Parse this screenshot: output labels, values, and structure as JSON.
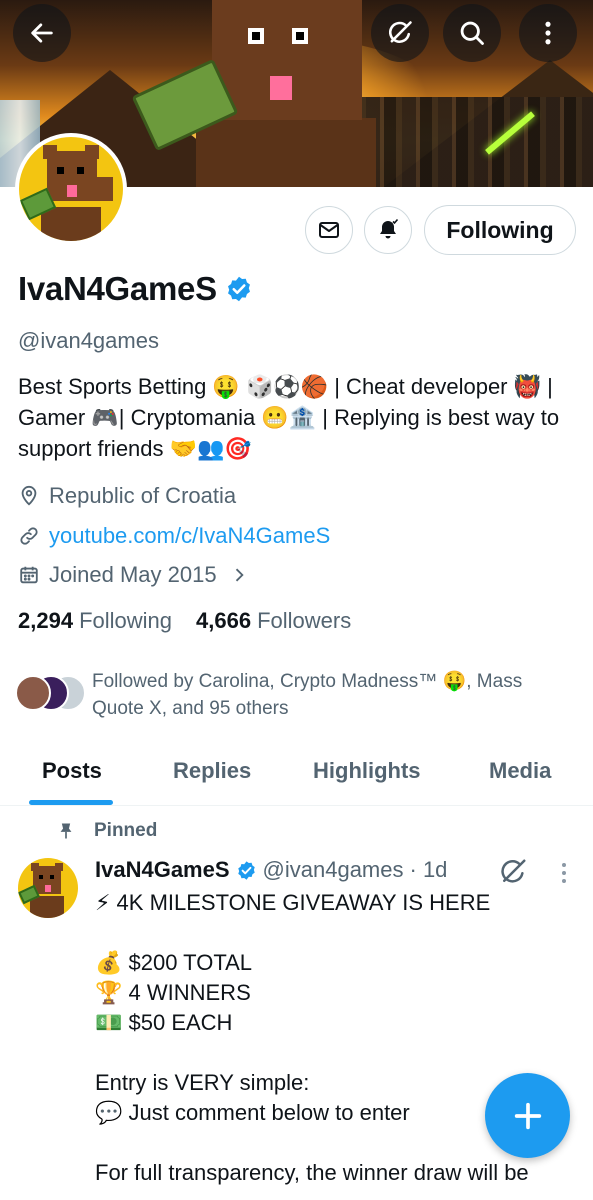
{
  "profile": {
    "name": "IvaN4GameS",
    "handle": "@ivan4games",
    "bio": "Best Sports Betting 🤑 🎲⚽🏀 | Cheat developer 👹 | Gamer 🎮| Cryptomania 😬🏦 | Replying is best way to support friends 🤝👥🎯",
    "location": "Republic of Croatia",
    "website": "youtube.com/c/IvaN4GameS",
    "joined": "Joined May 2015",
    "following_count": "2,294",
    "following_label": "Following",
    "followers_count": "4,666",
    "followers_label": "Followers",
    "followed_by": "Followed by Carolina, Crypto Madness™ 🤑, Mass Quote X, and 95 others"
  },
  "actions": {
    "follow_state": "Following"
  },
  "tabs": [
    {
      "label": "Posts",
      "active": true
    },
    {
      "label": "Replies",
      "active": false
    },
    {
      "label": "Highlights",
      "active": false
    },
    {
      "label": "Media",
      "active": false
    }
  ],
  "post": {
    "pinned_label": "Pinned",
    "author_name": "IvaN4GameS",
    "author_handle": "@ivan4games",
    "time": "· 1d",
    "lines": [
      "⚡ 4K MILESTONE GIVEAWAY IS HERE",
      "",
      "💰 $200 TOTAL",
      "🏆 4 WINNERS",
      "💵 $50 EACH",
      "",
      "Entry is VERY simple:",
      "💬 Just comment below to enter",
      "",
      "For full transparency, the winner draw will be"
    ]
  },
  "icons": {
    "back": "back-arrow-icon",
    "grok": "grok-icon",
    "search": "search-icon",
    "more": "more-vertical-icon",
    "message": "envelope-icon",
    "notify": "bell-icon",
    "verified": "verified-badge-icon",
    "location": "location-pin-icon",
    "link": "link-icon",
    "calendar": "calendar-icon",
    "pin": "pin-icon",
    "compose": "plus-icon"
  },
  "colors": {
    "accent": "#1d9bf0",
    "text": "#0f1419",
    "muted": "#536471",
    "border": "#cfd9de"
  }
}
